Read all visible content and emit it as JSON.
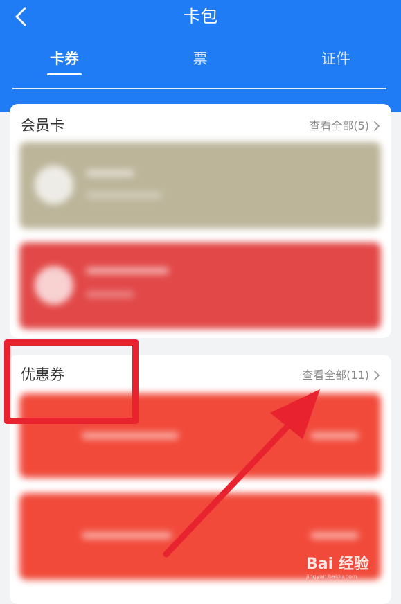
{
  "header": {
    "title": "卡包",
    "tabs": [
      {
        "label": "卡券",
        "active": true
      },
      {
        "label": "票",
        "active": false
      },
      {
        "label": "证件",
        "active": false
      }
    ],
    "accent_color": "#1f7cf4"
  },
  "member_cards": {
    "title": "会员卡",
    "view_all": "查看全部(5)"
  },
  "coupons": {
    "title": "优惠券",
    "view_all": "查看全部(11)"
  },
  "watermark": {
    "brand": "Bai 经验",
    "url": "jingyan.baidu.com"
  },
  "annotation_color": "#e8232f"
}
